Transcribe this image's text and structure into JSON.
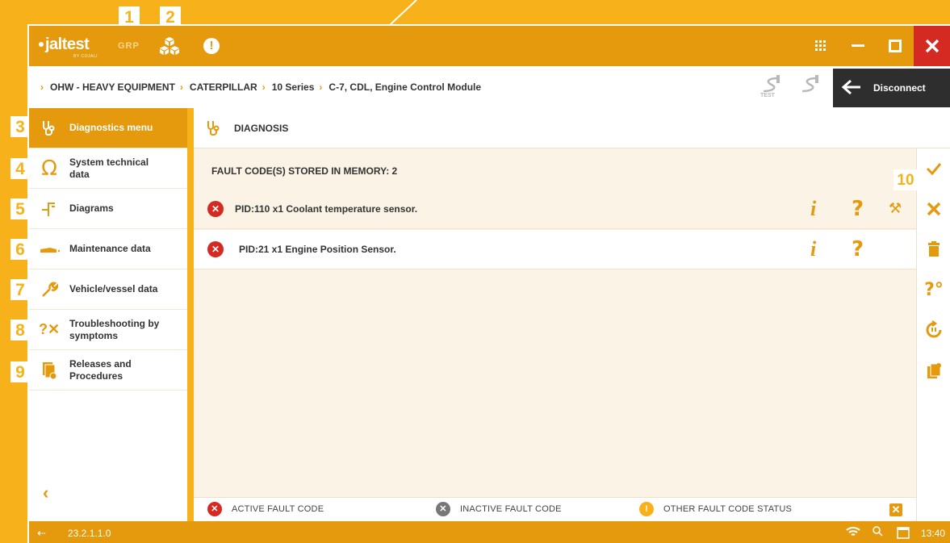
{
  "callouts": [
    "1",
    "2",
    "3",
    "4",
    "5",
    "6",
    "7",
    "8",
    "9",
    "10"
  ],
  "titlebar": {
    "logo": "jaltest",
    "logo_sub": "BY COJALI",
    "grp_label": "GRP",
    "alert_glyph": "!"
  },
  "breadcrumb": {
    "items": [
      "OHW - HEAVY EQUIPMENT",
      "CATERPILLAR",
      "10 Series",
      "C-7, CDL, Engine Control Module"
    ],
    "test_label": "TEST"
  },
  "disconnect_label": "Disconnect",
  "sidebar": {
    "items": [
      {
        "label": "Diagnostics menu"
      },
      {
        "label": "System technical data"
      },
      {
        "label": "Diagrams"
      },
      {
        "label": "Maintenance data"
      },
      {
        "label": "Vehicle/vessel data"
      },
      {
        "label": "Troubleshooting by symptoms"
      },
      {
        "label": "Releases and Procedures"
      }
    ]
  },
  "main": {
    "header": "DIAGNOSIS",
    "stored_label": "FAULT CODE(S) STORED IN MEMORY: 2",
    "faults": [
      {
        "text": "PID:110  x1  Coolant temperature sensor."
      },
      {
        "text": "PID:21   x1  Engine Position Sensor."
      }
    ],
    "legend": {
      "active": "ACTIVE FAULT CODE",
      "inactive": "INACTIVE FAULT CODE",
      "other": "OTHER FAULT CODE STATUS"
    }
  },
  "status": {
    "version": "23.2.1.1.0",
    "time": "13:40"
  },
  "colors": {
    "accent": "#E59A0E",
    "frame": "#F7B21B",
    "error": "#D42A22",
    "dark": "#2E2E2E"
  }
}
